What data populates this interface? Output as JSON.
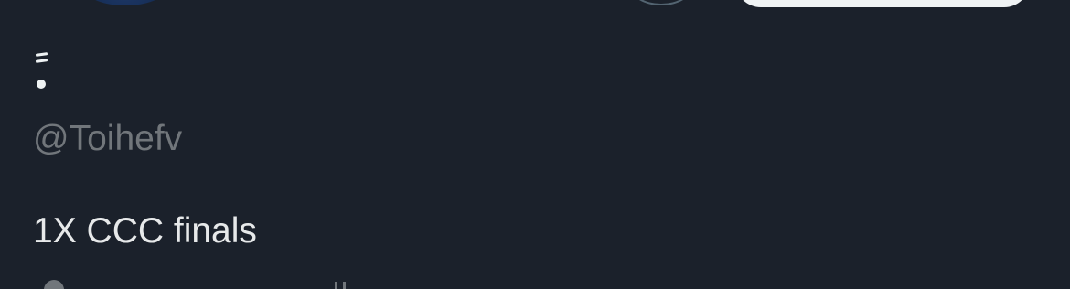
{
  "profile": {
    "display_name": "=•",
    "handle": "@Toihefv",
    "bio": "1X CCC finals"
  },
  "header": {
    "avatar_icon": "avatar-icon",
    "circle_button_icon": "circle-button-icon",
    "pill_button_icon": "pill-button-icon"
  },
  "footer": {
    "location_icon": "location-icon",
    "more_icon": "more-icon"
  },
  "colors": {
    "background": "#1b212b",
    "primary_text": "#e7e9ea",
    "secondary_text": "#71767b",
    "button_light": "#eff3f4"
  }
}
